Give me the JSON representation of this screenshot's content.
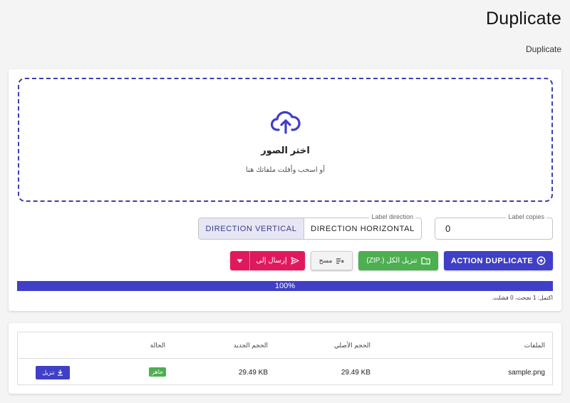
{
  "header": {
    "title": "Duplicate",
    "breadcrumb": "Duplicate"
  },
  "upload": {
    "icon": "cloud-upload-icon",
    "title": "اختر الصور",
    "subtitle": "أو اسحب وأفلت ملفاتك هنا",
    "accent": "#3f3fc7"
  },
  "options": {
    "copies_legend": "Label copies",
    "copies_value": "0",
    "direction_legend": "Label direction",
    "direction_vertical": "DIRECTION VERTICAL",
    "direction_horizontal": "DIRECTION HORIZONTAL",
    "direction_selected": "vertical"
  },
  "actions": {
    "duplicate_label": "ACTION DUPLICATE",
    "zip_label": "تنزيل الكل (.ZIP)",
    "clear_label": "مسح",
    "send_label": "إرسال إلى",
    "colors": {
      "primary": "#3f3fc7",
      "success": "#4caf50",
      "pink": "#e0195e"
    }
  },
  "progress": {
    "percent": 100,
    "label": "100%",
    "summary": "اكتمل: 1 نجحت، 0 فشلت."
  },
  "table": {
    "headers": {
      "files": "الملفات",
      "original_size": "الحجم الأصلي",
      "new_size": "الحجم الجديد",
      "status": "الحالة"
    },
    "rows": [
      {
        "file": "sample.png",
        "original_size": "29.49 KB",
        "new_size": "29.49 KB",
        "status": "جاهز",
        "action": "تنزيل"
      }
    ]
  }
}
